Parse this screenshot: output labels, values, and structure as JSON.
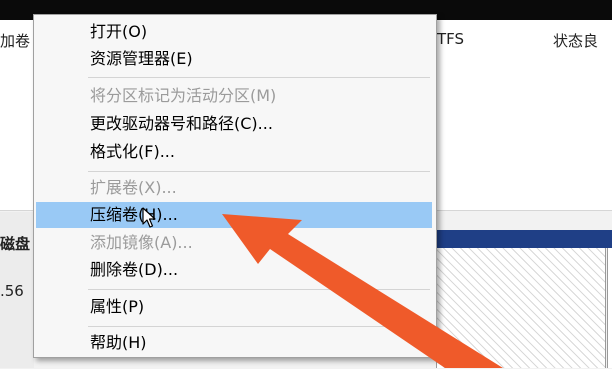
{
  "background": {
    "left_fragment_top": "加卷",
    "right_fragment_fs": "TFS",
    "right_fragment_status": "状态良",
    "left_fragment_disk": "磁盘",
    "left_fragment_number": ".56"
  },
  "context_menu": {
    "items": [
      {
        "label": "打开(O)",
        "enabled": true
      },
      {
        "label": "资源管理器(E)",
        "enabled": true
      },
      {
        "label": "将分区标记为活动分区(M)",
        "enabled": false
      },
      {
        "label": "更改驱动器号和路径(C)...",
        "enabled": true
      },
      {
        "label": "格式化(F)...",
        "enabled": true
      },
      {
        "label": "扩展卷(X)...",
        "enabled": false
      },
      {
        "label": "压缩卷(H)...",
        "enabled": true,
        "highlighted": true
      },
      {
        "label": "添加镜像(A)...",
        "enabled": false
      },
      {
        "label": "删除卷(D)...",
        "enabled": true
      },
      {
        "label": "属性(P)",
        "enabled": true
      },
      {
        "label": "帮助(H)",
        "enabled": true
      }
    ]
  },
  "colors": {
    "highlight": "#99c9f5",
    "arrow": "#ef5a2a",
    "volume_bar": "#1f3f86"
  },
  "icons": {
    "cursor": "mouse-pointer-icon",
    "annotation": "red-arrow-annotation"
  }
}
